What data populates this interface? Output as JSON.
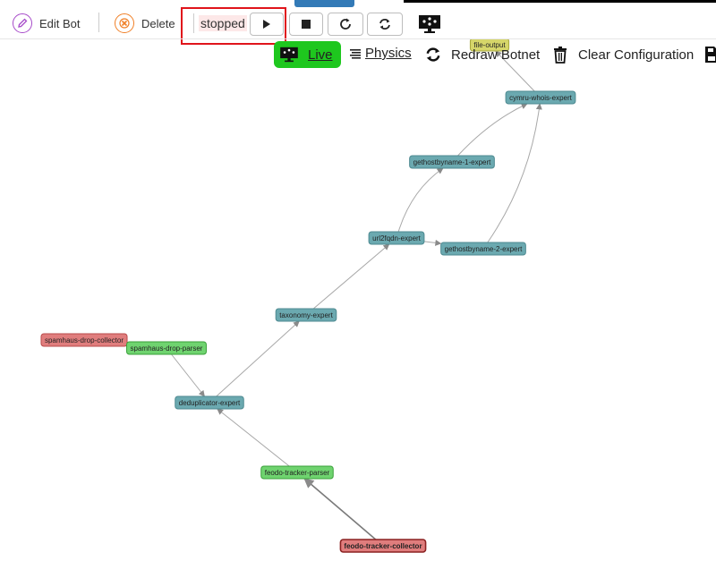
{
  "toolbar": {
    "edit_bot_label": "Edit Bot",
    "delete_label": "Delete",
    "status_text": "stopped"
  },
  "graph_toolbar": {
    "live_label": "Live",
    "physics_label": "Physics",
    "redraw_label": "Redraw Botnet",
    "clear_label": "Clear Configuration"
  },
  "colors": {
    "collector": "#e07d7d",
    "parser": "#6fd36f",
    "expert": "#6ba9b0",
    "output": "#d6d66a",
    "live_button": "#1ec71e",
    "highlight": "#e0141b"
  },
  "graph": {
    "nodes": [
      {
        "id": "file-output",
        "label": "file-output",
        "type": "output"
      },
      {
        "id": "cymru-whois-expert",
        "label": "cymru-whois-expert",
        "type": "expert"
      },
      {
        "id": "gethostbyname-1-expert",
        "label": "gethostbyname-1-expert",
        "type": "expert"
      },
      {
        "id": "url2fqdn-expert",
        "label": "url2fqdn-expert",
        "type": "expert"
      },
      {
        "id": "gethostbyname-2-expert",
        "label": "gethostbyname-2-expert",
        "type": "expert"
      },
      {
        "id": "taxonomy-expert",
        "label": "taxonomy-expert",
        "type": "expert"
      },
      {
        "id": "spamhaus-drop-collector",
        "label": "spamhaus-drop-collector",
        "type": "collector"
      },
      {
        "id": "spamhaus-drop-parser",
        "label": "spamhaus-drop-parser",
        "type": "parser"
      },
      {
        "id": "deduplicator-expert",
        "label": "deduplicator-expert",
        "type": "expert"
      },
      {
        "id": "feodo-tracker-parser",
        "label": "feodo-tracker-parser",
        "type": "parser"
      },
      {
        "id": "feodo-tracker-collector",
        "label": "feodo-tracker-collector",
        "type": "collector",
        "selected": true
      }
    ],
    "edges": [
      {
        "from": "feodo-tracker-collector",
        "to": "feodo-tracker-parser"
      },
      {
        "from": "feodo-tracker-parser",
        "to": "deduplicator-expert"
      },
      {
        "from": "spamhaus-drop-collector",
        "to": "spamhaus-drop-parser"
      },
      {
        "from": "spamhaus-drop-parser",
        "to": "deduplicator-expert"
      },
      {
        "from": "deduplicator-expert",
        "to": "taxonomy-expert"
      },
      {
        "from": "taxonomy-expert",
        "to": "url2fqdn-expert"
      },
      {
        "from": "url2fqdn-expert",
        "to": "gethostbyname-1-expert"
      },
      {
        "from": "url2fqdn-expert",
        "to": "gethostbyname-2-expert"
      },
      {
        "from": "gethostbyname-1-expert",
        "to": "cymru-whois-expert"
      },
      {
        "from": "gethostbyname-2-expert",
        "to": "cymru-whois-expert"
      },
      {
        "from": "cymru-whois-expert",
        "to": "file-output"
      }
    ]
  }
}
